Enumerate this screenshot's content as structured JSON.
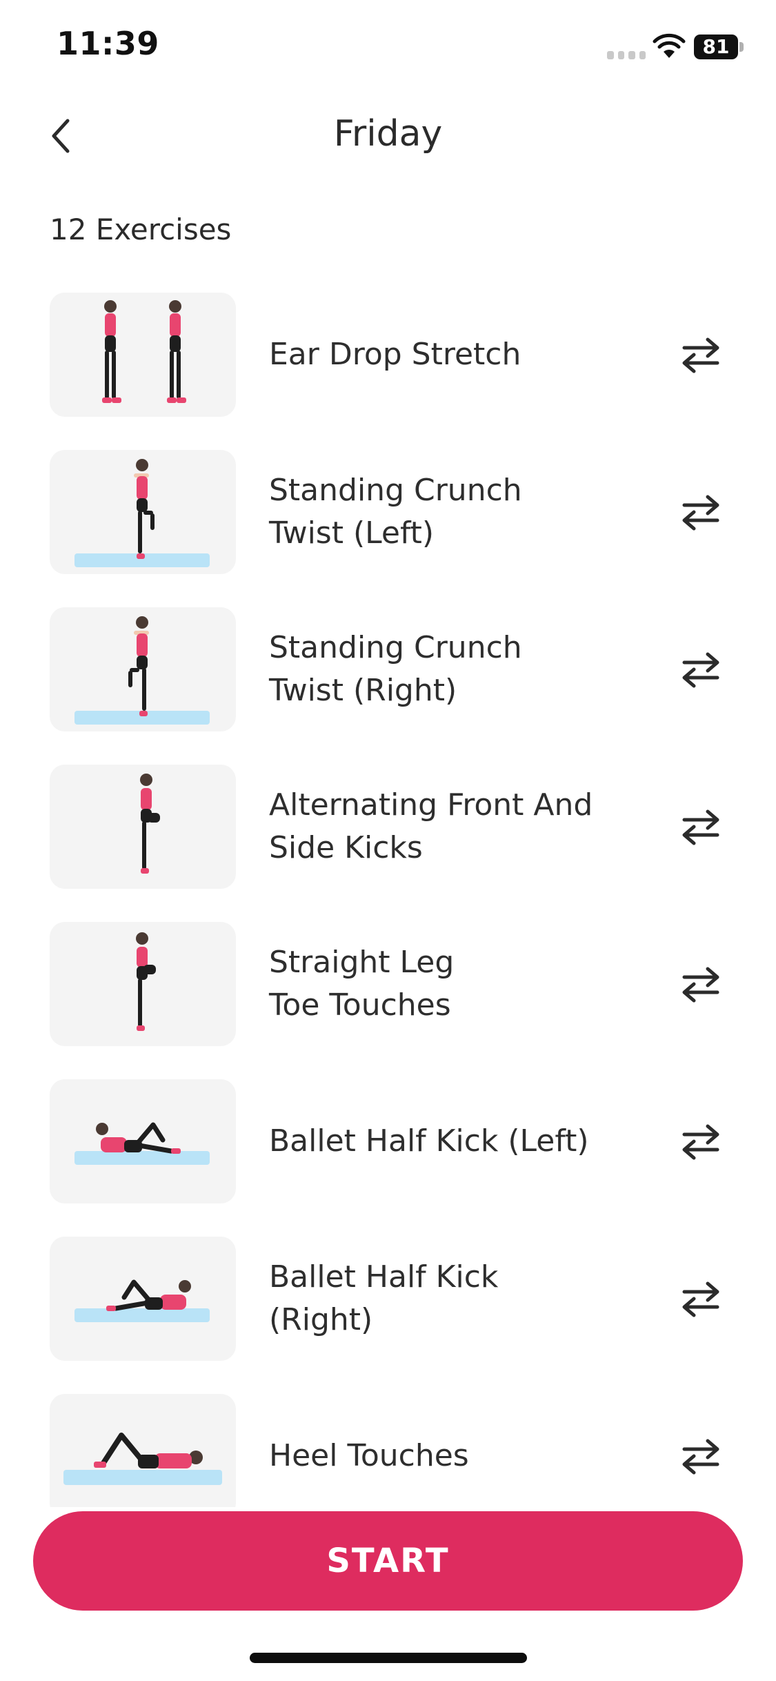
{
  "status_bar": {
    "time": "11:39",
    "battery": "81"
  },
  "header": {
    "title": "Friday"
  },
  "exercise_count_label": "12 Exercises",
  "exercises": [
    {
      "line1": "Ear Drop Stretch",
      "line2": ""
    },
    {
      "line1": "Standing Crunch",
      "line2": "Twist (Left)"
    },
    {
      "line1": "Standing Crunch",
      "line2": "Twist (Right)"
    },
    {
      "line1": "Alternating Front And",
      "line2": "Side Kicks"
    },
    {
      "line1": "Straight Leg",
      "line2": "Toe Touches"
    },
    {
      "line1": "Ballet Half Kick (Left)",
      "line2": ""
    },
    {
      "line1": "Ballet Half Kick",
      "line2": "(Right)"
    },
    {
      "line1": "Heel Touches",
      "line2": ""
    }
  ],
  "start_button": {
    "label": "START"
  },
  "colors": {
    "accent": "#de2c5f",
    "mat": "#b9e3f7",
    "top": "#e8456f"
  },
  "icons": {
    "back": "chevron-left-icon",
    "swap": "swap-arrows-icon"
  }
}
